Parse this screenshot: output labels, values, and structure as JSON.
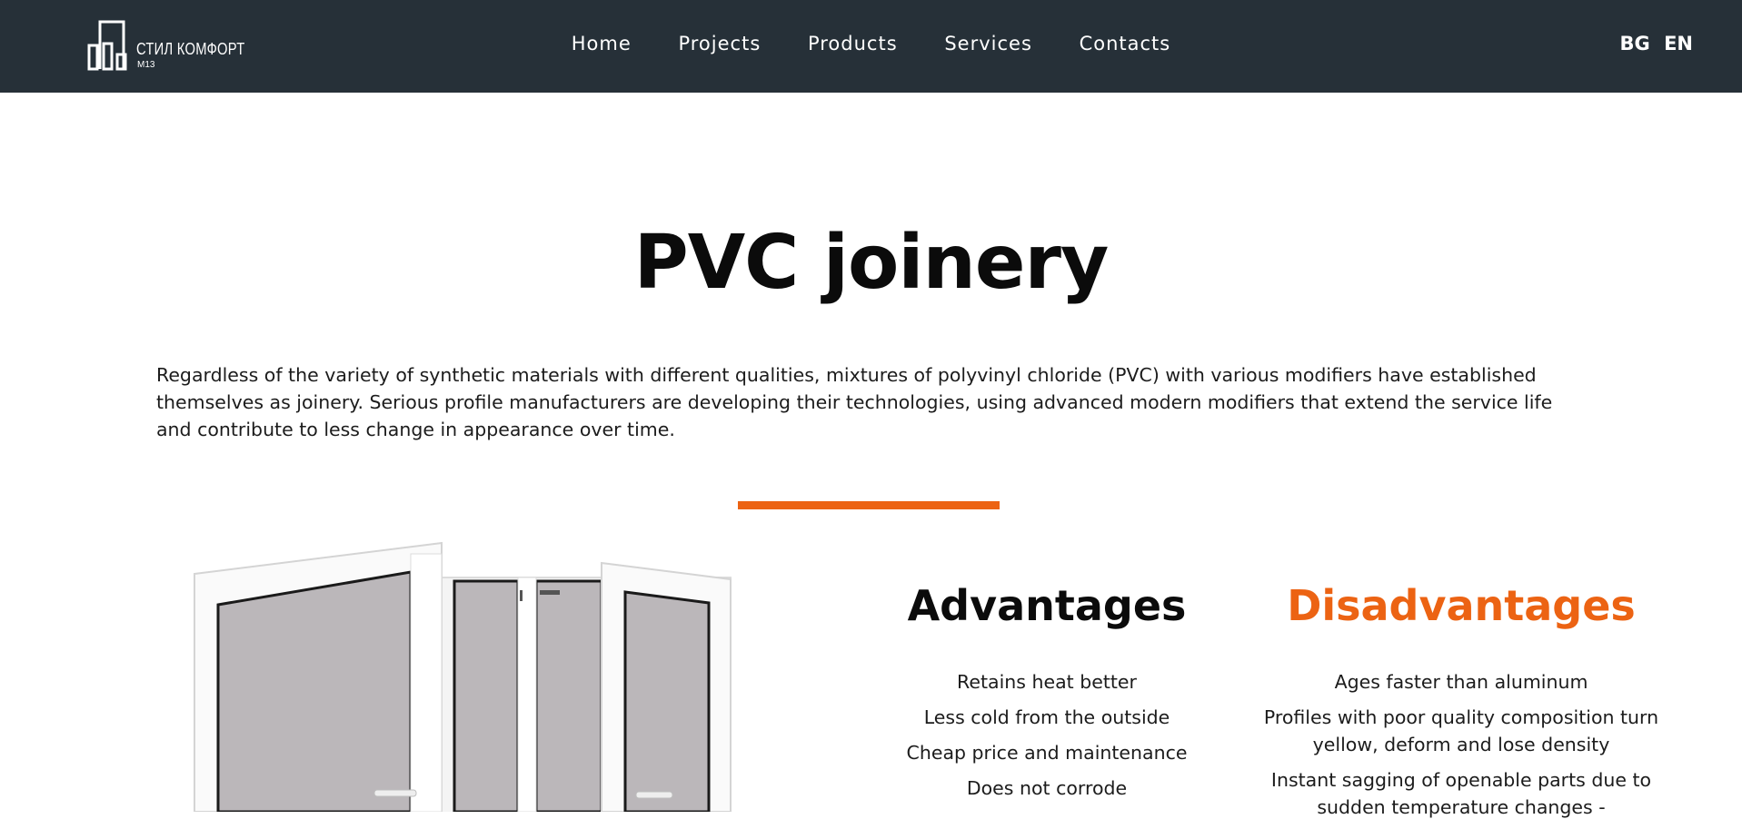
{
  "brand": {
    "name": "СТИЛ КОМФОРТ",
    "sub": "M13"
  },
  "nav": {
    "items": [
      {
        "label": "Home"
      },
      {
        "label": "Projects"
      },
      {
        "label": "Products"
      },
      {
        "label": "Services"
      },
      {
        "label": "Contacts"
      }
    ],
    "lang": {
      "bg": "BG",
      "en": "EN"
    }
  },
  "page": {
    "title": "PVC joinery",
    "intro": "Regardless of the variety of synthetic materials with different qualities, mixtures of polyvinyl chloride (PVC) with various modifiers have established themselves as joinery. Serious profile manufacturers are developing their technologies, using advanced modern modifiers that extend the service life and contribute to less change in appearance over time."
  },
  "advantages": {
    "title": "Advantages",
    "items": [
      "Retains heat better",
      "Less cold from the outside",
      "Cheap price and maintenance",
      "Does not corrode"
    ]
  },
  "disadvantages": {
    "title": "Disadvantages",
    "items": [
      "Ages faster than aluminum",
      "Profiles with poor quality composition turn yellow, deform and lose density",
      "Instant sagging of openable parts due to sudden temperature changes -"
    ]
  },
  "colors": {
    "header": "#263038",
    "accent": "#ec6313",
    "glass": "#bbb7ba"
  }
}
